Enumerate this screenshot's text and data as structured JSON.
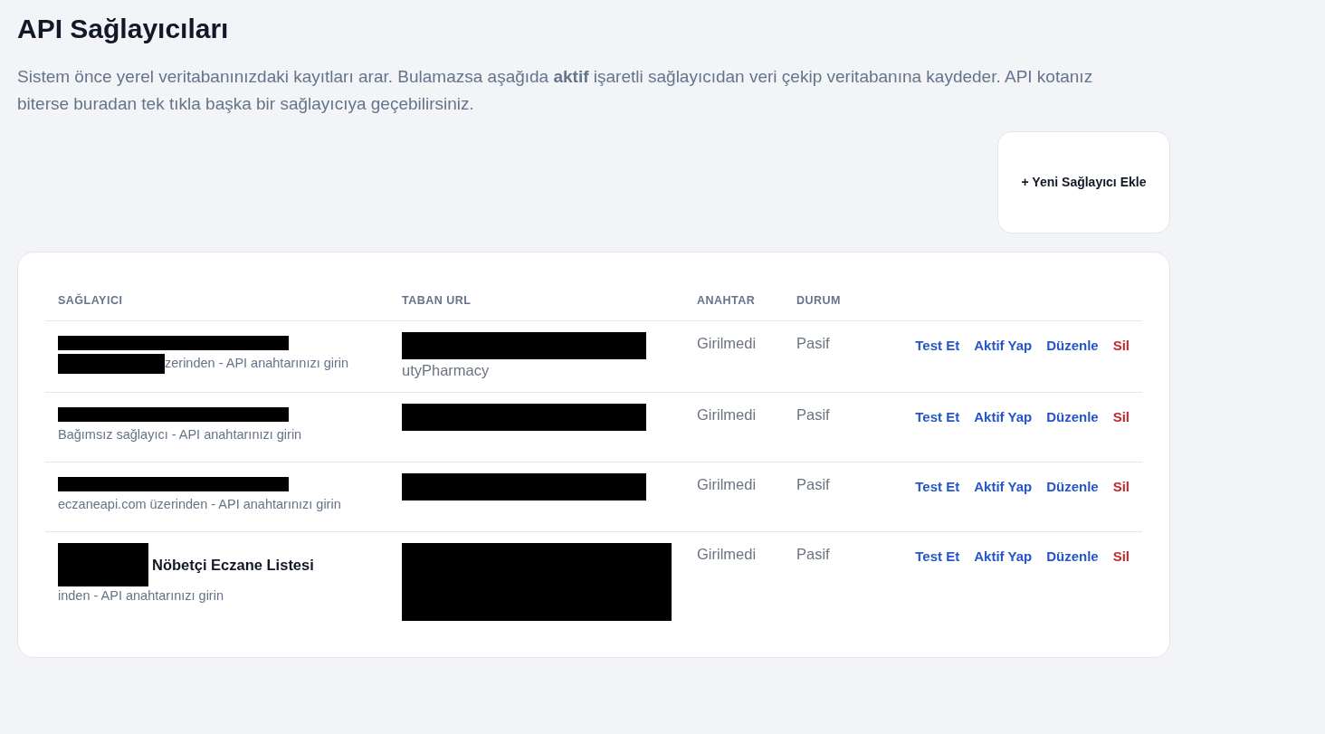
{
  "title": "API Sağlayıcıları",
  "intro": "Sistem önce yerel veritabanınızdaki kayıtları arar. Bulamazsa aşağıda **aktif** işaretli sağlayıcıdan veri çekip veritabanına kaydeder. API kotanız biterse buradan tek tıkla başka bir sağlayıcıya geçebilirsiniz.",
  "add_button": "+ Yeni Sağlayıcı Ekle",
  "table": {
    "columns": [
      "SAĞLAYICI",
      "TABAN URL",
      "ANAHTAR",
      "DURUM"
    ],
    "rows": [
      {
        "name_redacted": true,
        "description": "zerinden - API anahtarınızı girin",
        "description_redacted": true,
        "url": "utyPharmacy",
        "url_redacted": true,
        "key": "Girilmedi",
        "status": "Pasif",
        "actions": [
          {
            "label": "Test Et",
            "kind": "link"
          },
          {
            "label": "Aktif Yap",
            "kind": "link"
          },
          {
            "label": "Düzenle",
            "kind": "link"
          },
          {
            "label": "Sil",
            "kind": "danger"
          }
        ]
      },
      {
        "name_redacted": true,
        "description": "Bağımsız sağlayıcı - API anahtarınızı girin",
        "url_redacted": true,
        "key": "Girilmedi",
        "status": "Pasif",
        "actions": [
          {
            "label": "Test Et",
            "kind": "link"
          },
          {
            "label": "Aktif Yap",
            "kind": "link"
          },
          {
            "label": "Düzenle",
            "kind": "link"
          },
          {
            "label": "Sil",
            "kind": "danger"
          }
        ]
      },
      {
        "name_redacted": true,
        "description": "eczaneapi.com üzerinden - API anahtarınızı girin",
        "url_redacted": true,
        "key": "Girilmedi",
        "status": "Pasif",
        "actions": [
          {
            "label": "Test Et",
            "kind": "link"
          },
          {
            "label": "Aktif Yap",
            "kind": "link"
          },
          {
            "label": "Düzenle",
            "kind": "link"
          },
          {
            "label": "Sil",
            "kind": "danger"
          }
        ]
      },
      {
        "name": "Nöbetçi Eczane Listesi",
        "name_redacted": true,
        "description": "inden - API anahtarınızı girin",
        "url_redacted": true,
        "url_tall": true,
        "key": "Girilmedi",
        "status": "Pasif",
        "actions": [
          {
            "label": "Test Et",
            "kind": "link"
          },
          {
            "label": "Aktif Yap",
            "kind": "link"
          },
          {
            "label": "Düzenle",
            "kind": "link"
          },
          {
            "label": "Sil",
            "kind": "danger"
          }
        ]
      }
    ]
  }
}
